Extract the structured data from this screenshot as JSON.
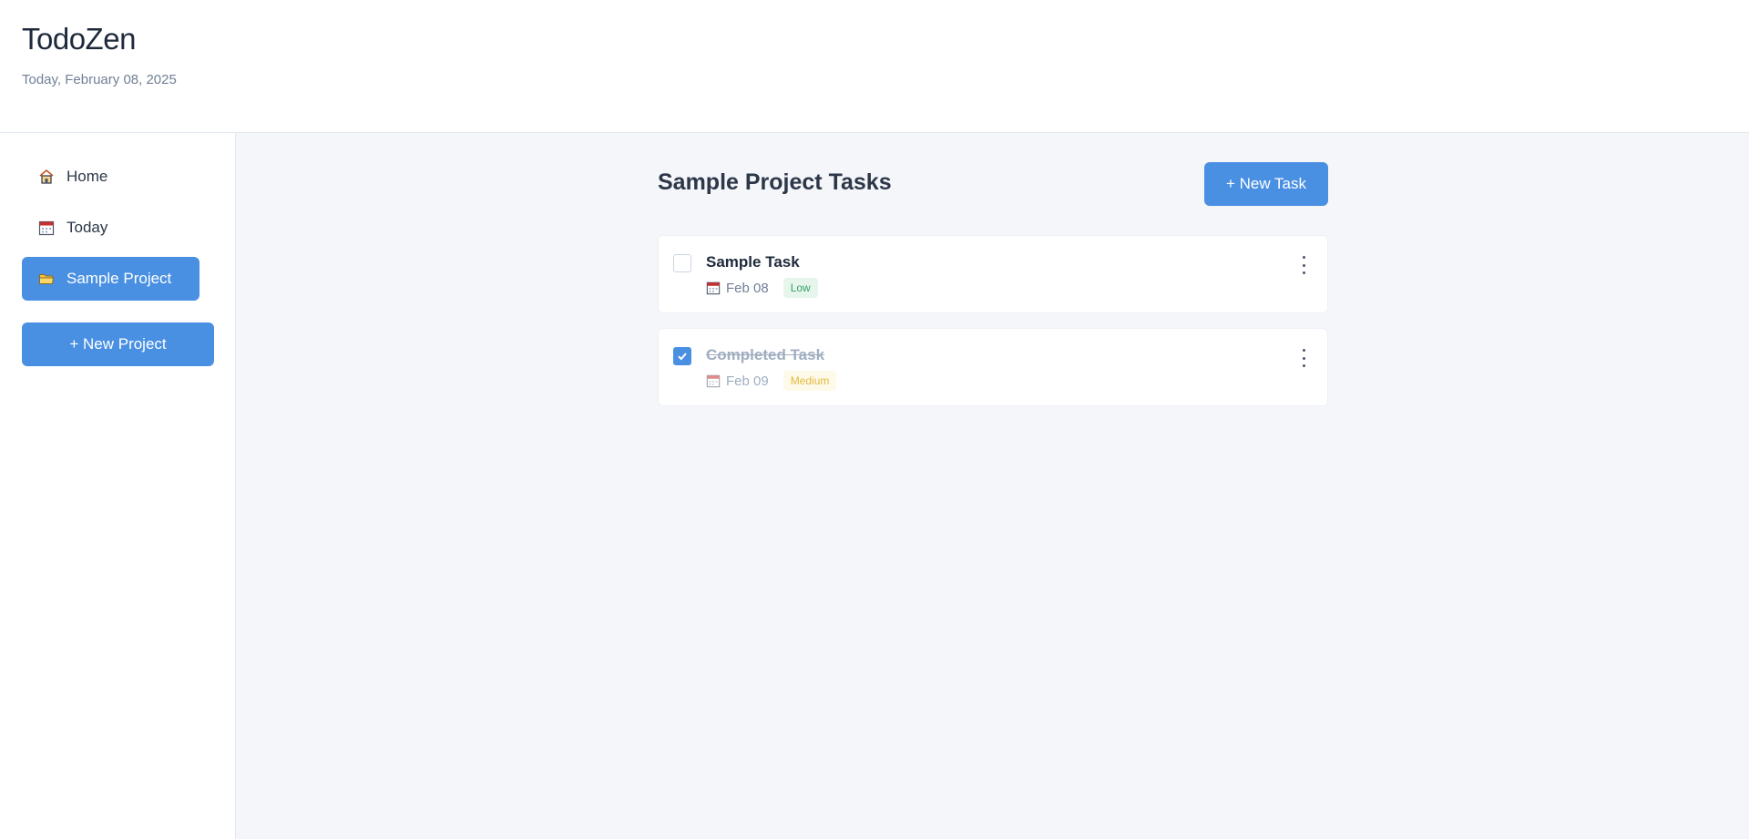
{
  "header": {
    "title": "TodoZen",
    "date": "Today, February 08, 2025"
  },
  "sidebar": {
    "items": [
      {
        "label": "Home",
        "icon": "home-icon"
      },
      {
        "label": "Today",
        "icon": "calendar-icon"
      },
      {
        "label": "Sample Project",
        "icon": "folder-icon",
        "active": true
      }
    ],
    "new_project_label": "+  New Project"
  },
  "main": {
    "title": "Sample Project Tasks",
    "new_task_label": "+ New Task",
    "tasks": [
      {
        "title": "Sample Task",
        "due": "Feb 08",
        "priority": "Low",
        "completed": false
      },
      {
        "title": "Completed Task",
        "due": "Feb 09",
        "priority": "Medium",
        "completed": true
      }
    ]
  },
  "colors": {
    "accent": "#4a90e2",
    "low": "#38a169",
    "medium": "#e2b93b"
  }
}
